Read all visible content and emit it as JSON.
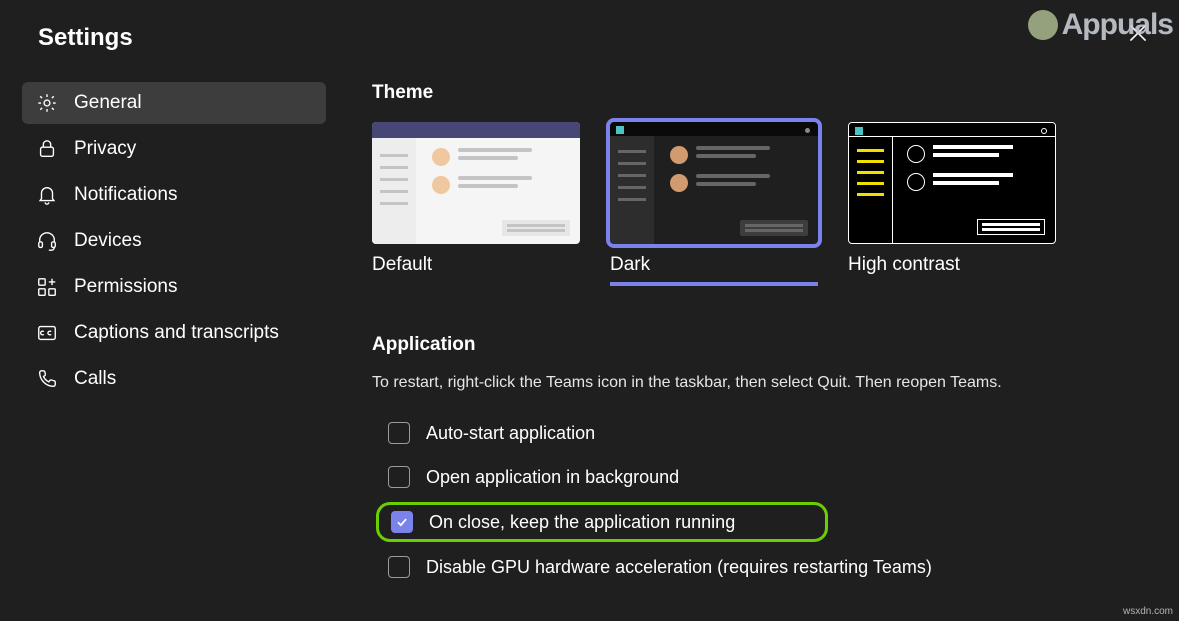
{
  "window": {
    "title": "Settings"
  },
  "sidebar": {
    "items": [
      {
        "label": "General",
        "selected": true
      },
      {
        "label": "Privacy",
        "selected": false
      },
      {
        "label": "Notifications",
        "selected": false
      },
      {
        "label": "Devices",
        "selected": false
      },
      {
        "label": "Permissions",
        "selected": false
      },
      {
        "label": "Captions and transcripts",
        "selected": false
      },
      {
        "label": "Calls",
        "selected": false
      }
    ]
  },
  "theme": {
    "heading": "Theme",
    "options": [
      {
        "label": "Default",
        "selected": false
      },
      {
        "label": "Dark",
        "selected": true
      },
      {
        "label": "High contrast",
        "selected": false
      }
    ]
  },
  "application": {
    "heading": "Application",
    "description": "To restart, right-click the Teams icon in the taskbar, then select Quit. Then reopen Teams.",
    "options": [
      {
        "label": "Auto-start application",
        "checked": false,
        "highlighted": false
      },
      {
        "label": "Open application in background",
        "checked": false,
        "highlighted": false
      },
      {
        "label": "On close, keep the application running",
        "checked": true,
        "highlighted": true
      },
      {
        "label": "Disable GPU hardware acceleration (requires restarting Teams)",
        "checked": false,
        "highlighted": false
      }
    ]
  },
  "watermark": {
    "brand": "Appuals",
    "footer": "wsxdn.com"
  }
}
